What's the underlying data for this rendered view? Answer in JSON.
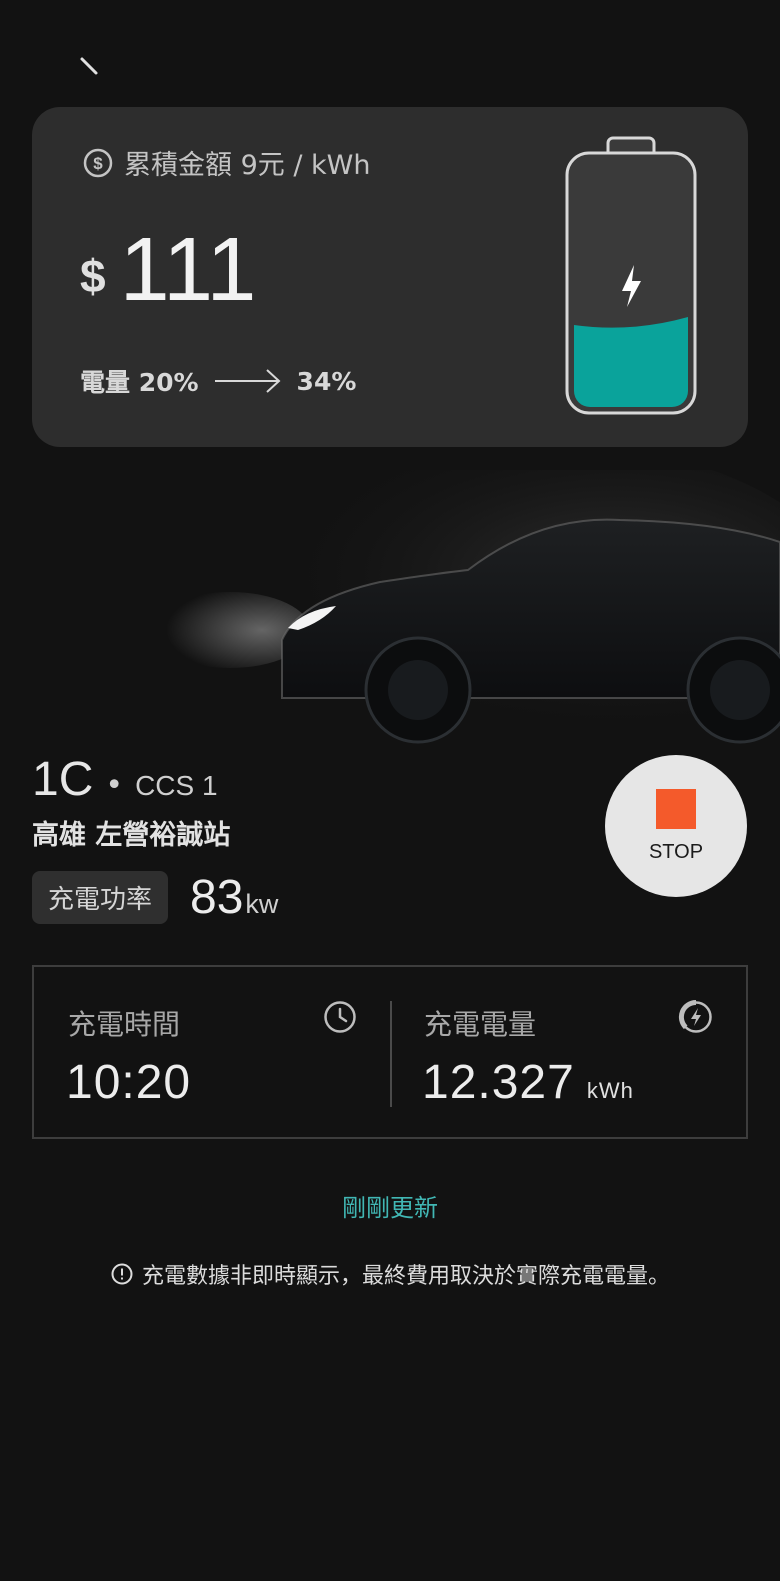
{
  "summary": {
    "rate_label": "累積金額 9元 / kWh",
    "currency": "$",
    "amount": "111",
    "soc_label": "電量 20%",
    "soc_target": "34%",
    "battery_fill": 0.34
  },
  "station": {
    "code": "1C",
    "separator": "•",
    "connector": "CCS 1",
    "name": "高雄 左營裕誠站",
    "power_label": "充電功率",
    "power_value": "83",
    "power_unit": "kw"
  },
  "stop_button": {
    "label": "STOP",
    "color": "#f45a2b"
  },
  "stats": {
    "time_label": "充電時間",
    "time_value": "10:20",
    "energy_label": "充電電量",
    "energy_value": "12.327",
    "energy_unit": "kWh"
  },
  "refresh_label": "剛剛更新",
  "notice_text": "充電數據非即時顯示，最終費用取決於實際充電電量。",
  "colors": {
    "accent": "#41b7b4",
    "battery": "#0aa39b",
    "card": "#2d2d2d",
    "background": "#121212"
  }
}
